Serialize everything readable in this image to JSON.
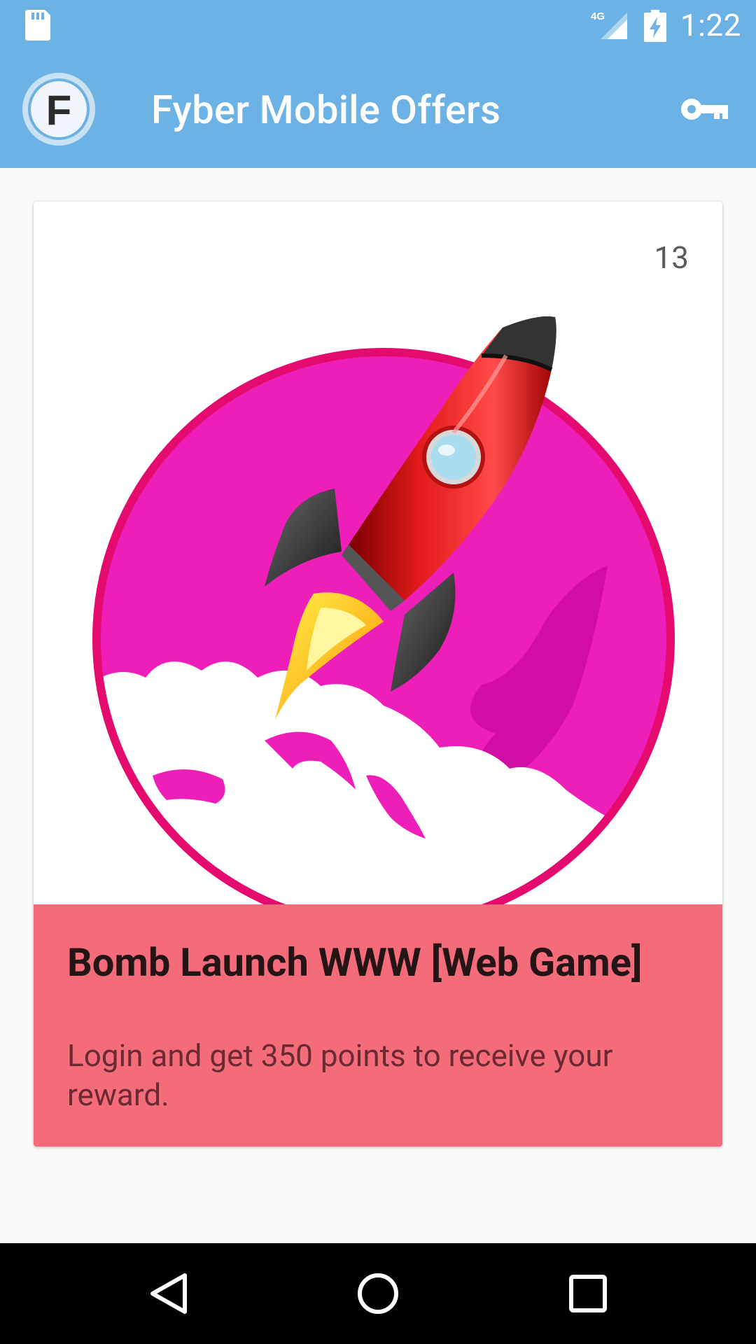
{
  "status_bar": {
    "time": "1:22",
    "network": "4G",
    "icons": [
      "sd-card-icon",
      "signal-icon",
      "battery-charging-icon"
    ]
  },
  "app_bar": {
    "title": "Fyber Mobile Offers",
    "logo_letter": "F",
    "action_icon": "key-icon"
  },
  "offer": {
    "count": "13",
    "title": "Bomb Launch WWW [Web Game]",
    "description": "Login and get 350 points to receive your reward.",
    "image_icon": "rocket-launch-icon"
  },
  "nav_bar": {
    "icons": [
      "back-icon",
      "home-icon",
      "recents-icon"
    ]
  },
  "colors": {
    "primary": "#6cb2e4",
    "card_info_bg": "#f46b79",
    "rocket_circle": "#ee1fb8",
    "rocket_body": "#d41414"
  }
}
